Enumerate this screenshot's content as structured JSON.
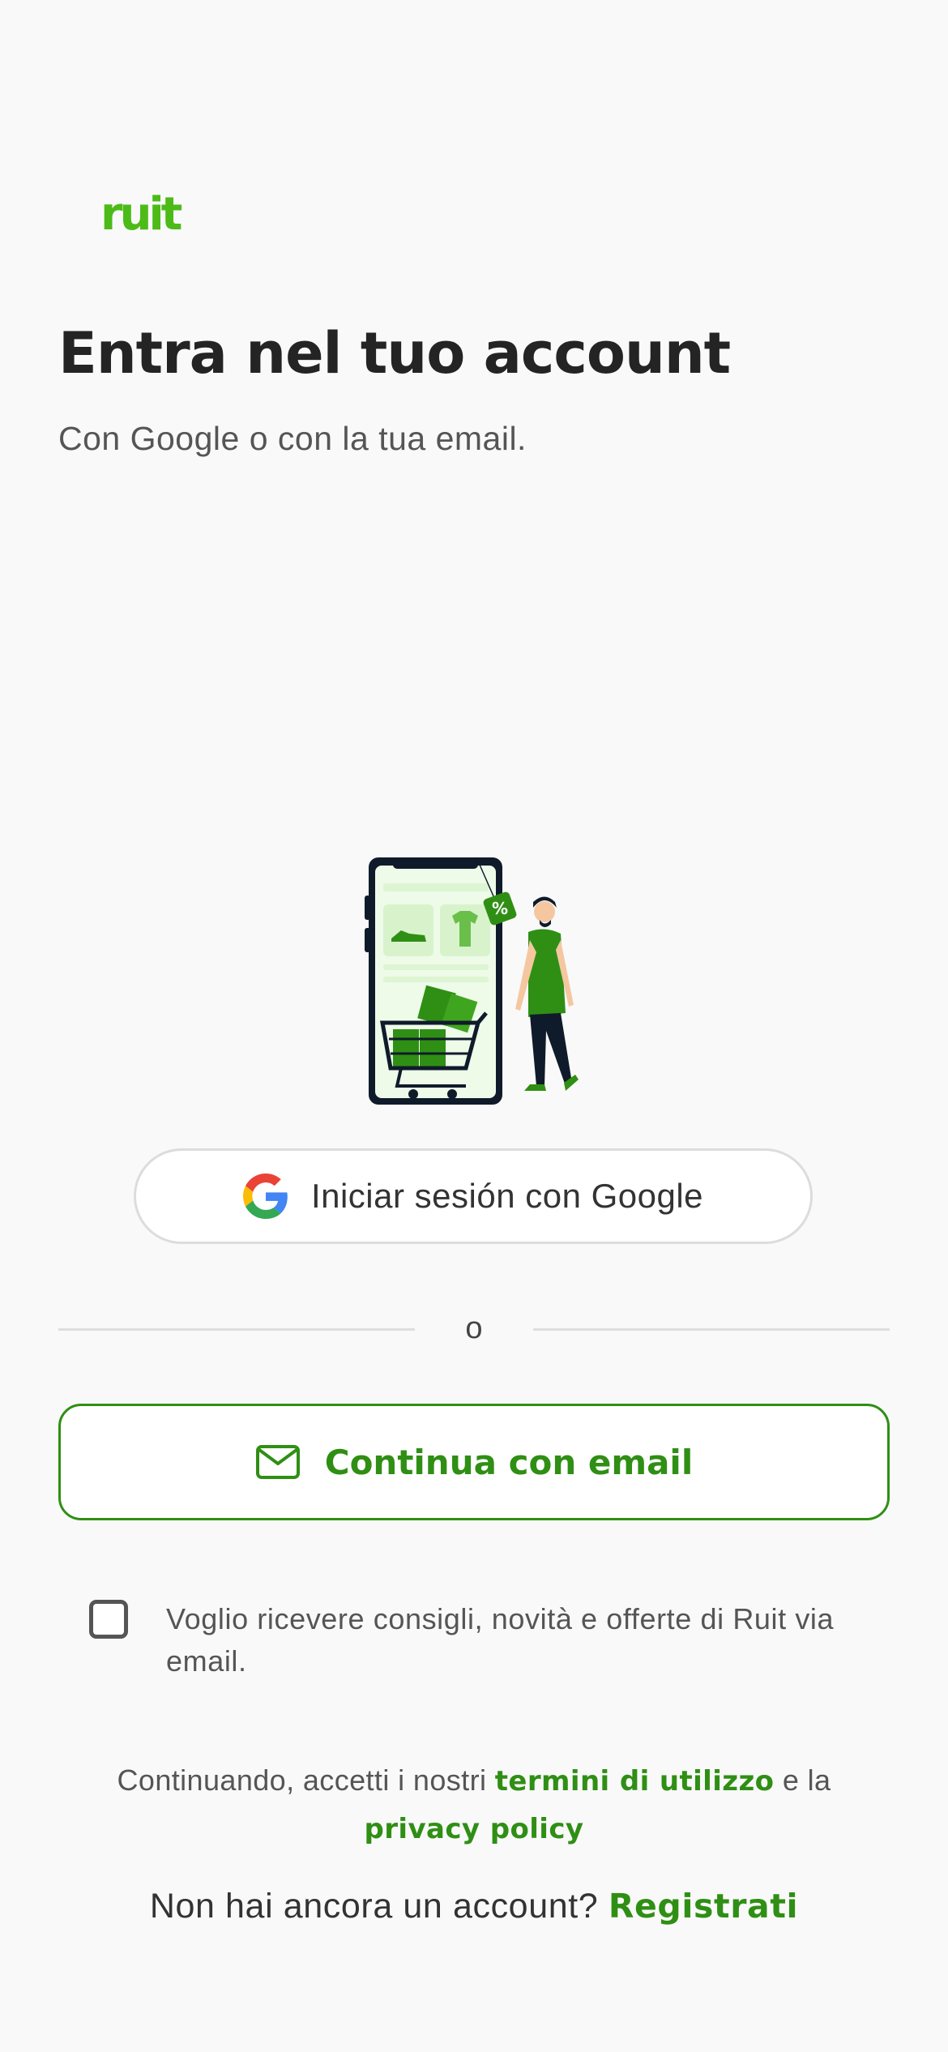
{
  "brand": {
    "logo_text": "ruit",
    "accent_color": "#4cbb17",
    "primary_green": "#2f8f14"
  },
  "header": {
    "title": "Entra nel tuo account",
    "subtitle": "Con Google o con la tua email."
  },
  "illustration": {
    "icon": "shopping-illustration"
  },
  "google_button": {
    "label": "Iniciar sesión con Google",
    "icon": "google-logo-icon"
  },
  "divider": {
    "label": "o"
  },
  "email_button": {
    "label": "Continua con email",
    "icon": "mail-icon"
  },
  "newsletter": {
    "checked": false,
    "label": "Voglio ricevere consigli, novità e offerte di Ruit via email."
  },
  "legal": {
    "prefix": "Continuando, accetti i nostri ",
    "terms_link": "termini di utilizzo",
    "middle": " e la ",
    "privacy_link": "privacy policy"
  },
  "register": {
    "prompt": "Non hai ancora un account? ",
    "link": "Registrati"
  }
}
